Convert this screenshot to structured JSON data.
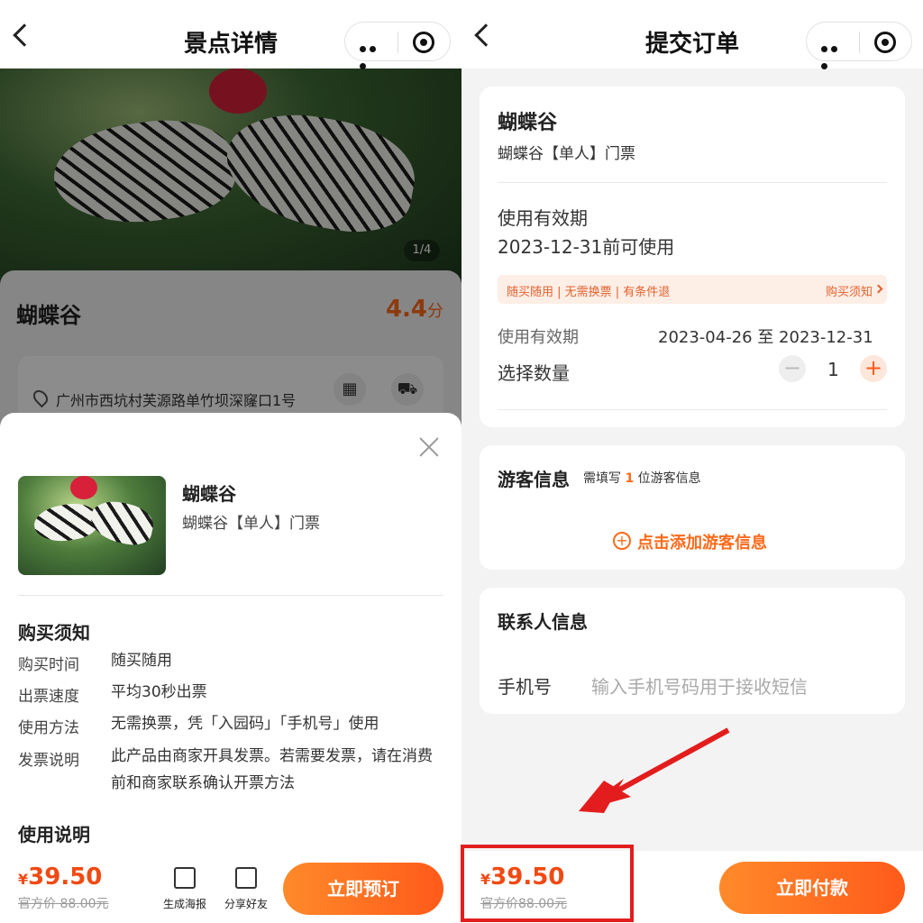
{
  "left": {
    "nav": {
      "title": "景点详情"
    },
    "hero": {
      "counter": "1/4"
    },
    "spot": {
      "name": "蝴蝶谷",
      "rating": "4.4",
      "rating_unit": "分",
      "address": "广州市西坑村芙源路单竹坝深窿口1号"
    },
    "sheet": {
      "name": "蝴蝶谷",
      "ticket": "蝴蝶谷【单人】门票",
      "purchase_title": "购买须知",
      "rows": [
        {
          "k": "购买时间",
          "v": "随买随用"
        },
        {
          "k": "出票速度",
          "v": "平均30秒出票"
        },
        {
          "k": "使用方法",
          "v": "无需换票，凭「入园码」「手机号」使用"
        },
        {
          "k": "发票说明",
          "v": "此产品由商家开具发票。若需要发票，请在消费前和商家联系确认开票方法"
        }
      ],
      "usage_title": "使用说明"
    },
    "bar": {
      "currency": "¥",
      "price": "39.50",
      "orig": "官方价 88.00元",
      "poster": "生成海报",
      "share": "分享好友",
      "book": "立即预订"
    }
  },
  "right": {
    "nav": {
      "title": "提交订单"
    },
    "order": {
      "name": "蝴蝶谷",
      "ticket": "蝴蝶谷【单人】门票",
      "valid_title": "使用有效期",
      "valid_text": "2023-12-31前可使用",
      "tags": "随买随用 | 无需换票 | 有条件退",
      "notice_link": "购买须知",
      "valid_label": "使用有效期",
      "valid_range": "2023-04-26 至 2023-12-31",
      "qty_label": "选择数量",
      "qty": "1"
    },
    "visitor": {
      "title": "游客信息",
      "hint_prefix": "需填写",
      "hint_count": "1",
      "hint_suffix": "位游客信息",
      "add": "点击添加游客信息"
    },
    "contact": {
      "title": "联系人信息",
      "phone_label": "手机号",
      "phone_placeholder": "输入手机号码用于接收短信"
    },
    "bar": {
      "currency": "¥",
      "price": "39.50",
      "orig": "官方价88.00元",
      "pay": "立即付款"
    }
  },
  "colors": {
    "accent": "#ff6a1a",
    "price": "#f04a14",
    "highlight": "#e31d1d"
  }
}
